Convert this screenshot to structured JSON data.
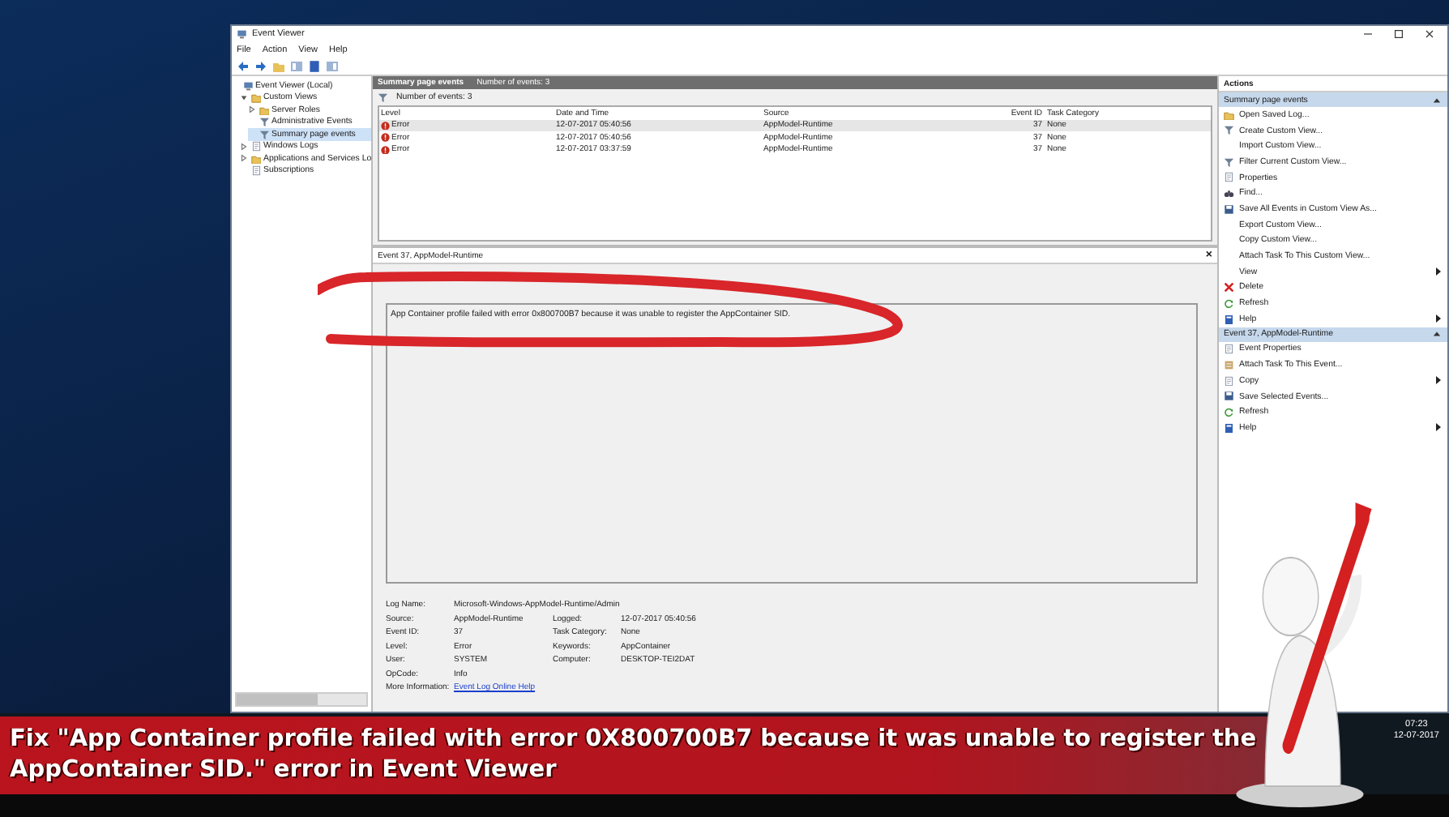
{
  "window": {
    "title": "Event Viewer"
  },
  "menu": [
    "File",
    "Action",
    "View",
    "Help"
  ],
  "tree": [
    {
      "label": "Event Viewer (Local)",
      "kind": "computer",
      "selected": false,
      "children": [
        {
          "label": "Custom Views",
          "kind": "folder",
          "expanded": true,
          "selected": false,
          "children": [
            {
              "label": "Server Roles",
              "kind": "folder",
              "expanded": false,
              "selected": false
            },
            {
              "label": "Administrative Events",
              "kind": "filter",
              "selected": false
            },
            {
              "label": "Summary page events",
              "kind": "filter",
              "selected": true
            }
          ]
        },
        {
          "label": "Windows Logs",
          "kind": "log",
          "expanded": false,
          "selected": false
        },
        {
          "label": "Applications and Services Lo",
          "kind": "folder",
          "expanded": false,
          "selected": false
        },
        {
          "label": "Subscriptions",
          "kind": "log",
          "selected": false
        }
      ]
    }
  ],
  "events_pane": {
    "title": "Summary page events",
    "count": "Number of events: 3",
    "filter": "Number of events: 3",
    "columns": [
      "Level",
      "Date and Time",
      "Source",
      "Event ID",
      "Task Category"
    ],
    "rows": [
      {
        "level": "Error",
        "date": "12-07-2017 05:40:56",
        "source": "AppModel-Runtime",
        "event_id": "37",
        "category": "None",
        "selected": true
      },
      {
        "level": "Error",
        "date": "12-07-2017 05:40:56",
        "source": "AppModel-Runtime",
        "event_id": "37",
        "category": "None",
        "selected": false
      },
      {
        "level": "Error",
        "date": "12-07-2017 03:37:59",
        "source": "AppModel-Runtime",
        "event_id": "37",
        "category": "None",
        "selected": false
      }
    ]
  },
  "detail_pane": {
    "title": "Event 37, AppModel-Runtime",
    "close": "×",
    "message": "App Container profile failed with error 0x800700B7 because it was unable to register the AppContainer SID.",
    "fields": [
      [
        {
          "label": "Log Name:",
          "value": "Microsoft-Windows-AppModel-Runtime/Admin",
          "link": false
        }
      ],
      [
        {
          "label": "Source:",
          "value": "AppModel-Runtime",
          "link": false
        },
        {
          "label": "Logged:",
          "value": "12-07-2017 05:40:56",
          "link": false
        }
      ],
      [
        {
          "label": "Event ID:",
          "value": "37",
          "link": false
        },
        {
          "label": "Task Category:",
          "value": "None",
          "link": false
        }
      ],
      [
        {
          "label": "Level:",
          "value": "Error",
          "link": false
        },
        {
          "label": "Keywords:",
          "value": "AppContainer",
          "link": false
        }
      ],
      [
        {
          "label": "User:",
          "value": "SYSTEM",
          "link": false
        },
        {
          "label": "Computer:",
          "value": "DESKTOP-TEI2DAT",
          "link": false
        }
      ],
      [
        {
          "label": "OpCode:",
          "value": "Info",
          "link": false
        }
      ],
      [
        {
          "label": "More Information:",
          "value": "Event Log Online Help",
          "link": true
        }
      ]
    ]
  },
  "actions": {
    "title": "Actions",
    "sections": [
      {
        "title": "Summary page events",
        "items": [
          {
            "label": "Open Saved Log...",
            "kind": "open",
            "submenu": false
          },
          {
            "label": "Create Custom View...",
            "kind": "filter",
            "submenu": false
          },
          {
            "label": "Import Custom View...",
            "kind": "none",
            "submenu": false
          },
          {
            "label": "Filter Current Custom View...",
            "kind": "filter",
            "submenu": false
          },
          {
            "label": "Properties",
            "kind": "properties",
            "submenu": false
          },
          {
            "label": "Find...",
            "kind": "find",
            "submenu": false
          },
          {
            "label": "Save All Events in Custom View As...",
            "kind": "save",
            "submenu": false
          },
          {
            "label": "Export Custom View...",
            "kind": "none",
            "submenu": false
          },
          {
            "label": "Copy Custom View...",
            "kind": "none",
            "submenu": false
          },
          {
            "label": "Attach Task To This Custom View...",
            "kind": "none",
            "submenu": false
          },
          {
            "label": "View",
            "kind": "none",
            "submenu": true
          },
          {
            "label": "Delete",
            "kind": "delete",
            "submenu": false
          },
          {
            "label": "Refresh",
            "kind": "refresh",
            "submenu": false
          },
          {
            "label": "Help",
            "kind": "help",
            "submenu": true
          }
        ]
      },
      {
        "title": "Event 37, AppModel-Runtime",
        "items": [
          {
            "label": "Event Properties",
            "kind": "properties",
            "submenu": false
          },
          {
            "label": "Attach Task To This Event...",
            "kind": "task",
            "submenu": false
          },
          {
            "label": "Copy",
            "kind": "copy",
            "submenu": true
          },
          {
            "label": "Save Selected Events...",
            "kind": "save",
            "submenu": false
          },
          {
            "label": "Refresh",
            "kind": "refresh",
            "submenu": false
          },
          {
            "label": "Help",
            "kind": "help",
            "submenu": true
          }
        ]
      }
    ]
  },
  "taskbar": {
    "time": "07:23",
    "date": "12-07-2017"
  },
  "caption": "Fix \"App Container profile failed with error 0X800700B7 because it was unable to register the AppContainer SID.\" error in Event Viewer"
}
